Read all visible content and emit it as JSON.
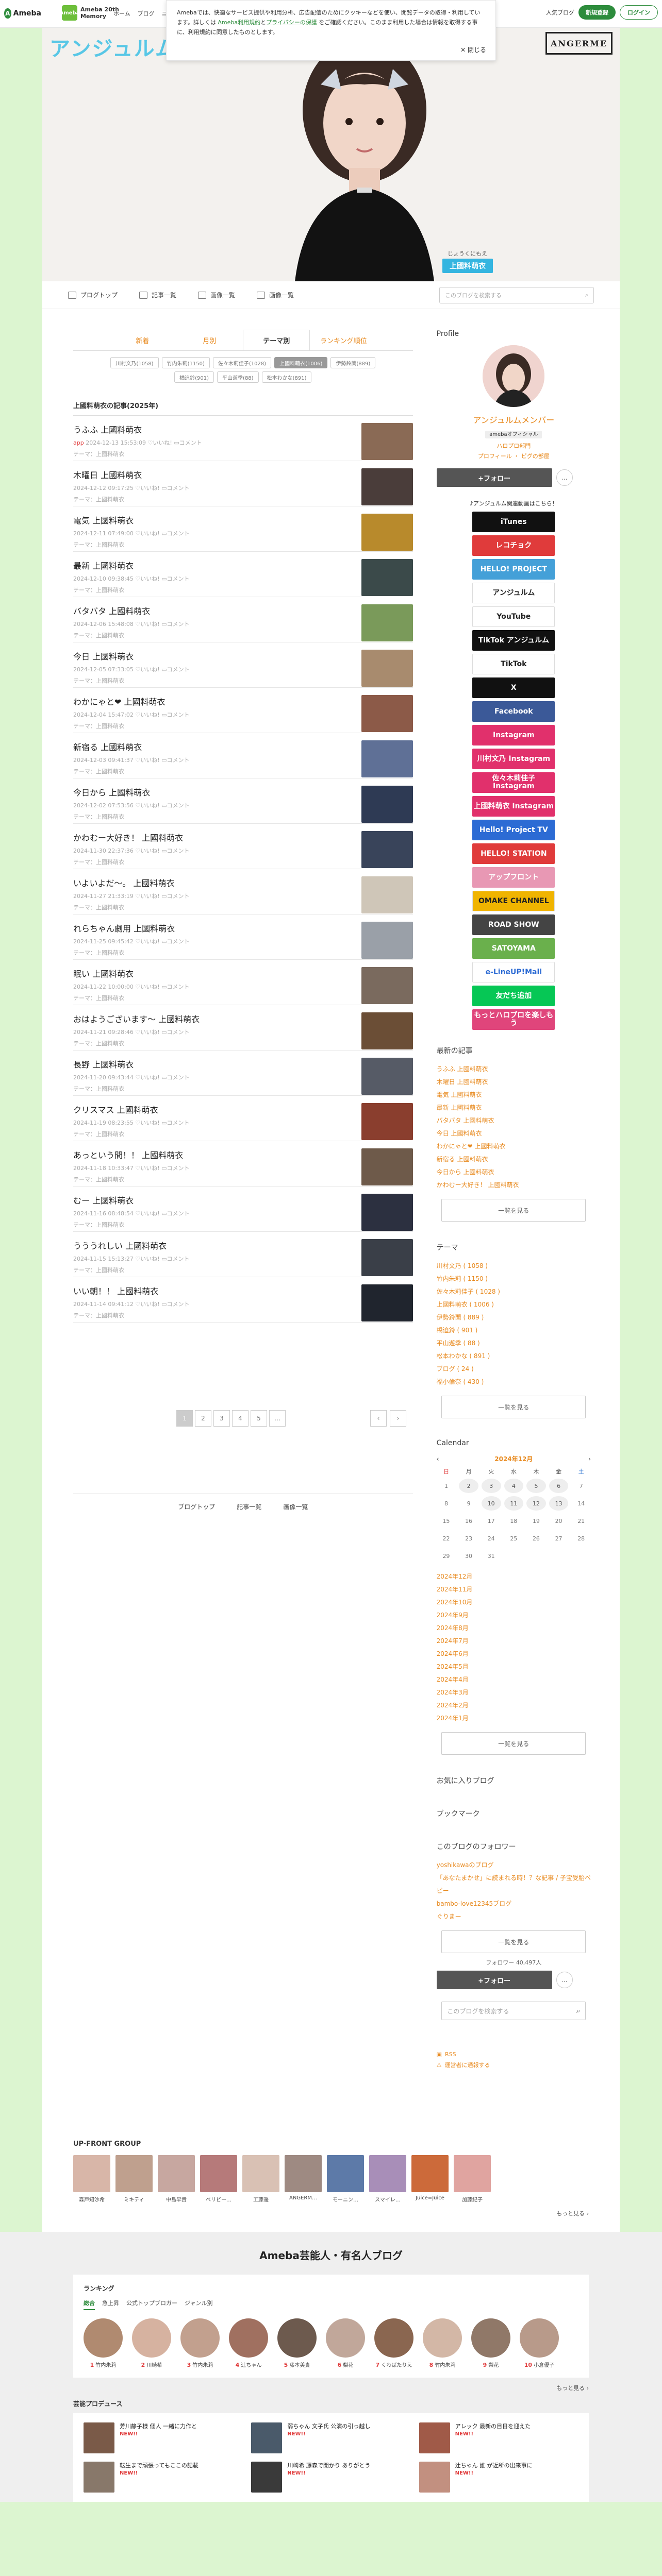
{
  "topbar": {
    "logo_text": "Ameba",
    "blogs_badge": "Ameba",
    "blogs_title": "Ameba 20th Memory",
    "nav": [
      "ホーム",
      "ブログ",
      "ニュース"
    ],
    "small_link": "人気ブログ",
    "register": "新規登録",
    "login": "ログイン"
  },
  "cookie": {
    "text1": "Amebaでは、快適なサービス提供や利用分析、広告配信のためにクッキーなどを使い、閲覧データの取得・利用しています。詳しくは",
    "link1": "Ameba利用規約",
    "and": "と",
    "link2": "プライバシーの保護",
    "text2": "をご確認ください。このまま利用した場合は情報を取得する事に、利用規約に同意したものとします。",
    "close": "閉じる"
  },
  "hero": {
    "title": "アンジュルム",
    "brand": "ANGERME",
    "name_kana": "じょうくにもえ",
    "name_tag": "上國料萌衣"
  },
  "blog_nav": {
    "top": "ブログトップ",
    "entries": "記事一覧",
    "images": "画像一覧",
    "search_placeholder": "このブログを検索する"
  },
  "tabs": {
    "items": [
      "新着",
      "月別",
      "テーマ別",
      "ランキング順位"
    ],
    "active": 2
  },
  "chips": [
    "川村文乃(1058)",
    "竹内朱莉(1150)",
    "佐々木莉佳子(1028)",
    "上國料萌衣(1006)",
    "伊勢鈴蘭(889)",
    "橋迫鈴(901)",
    "平山遊季(88)",
    "松本わかな(891)"
  ],
  "chips_active": 3,
  "section_heading": "上國料萌衣の記事(2025年)",
  "entries": [
    {
      "title": "うふふ 上國料萌衣",
      "date": "2024-12-13 15:53:09",
      "app": "app",
      "likes": "いいね!",
      "comments": "コメント",
      "theme": "テーマ：上國料萌衣",
      "img": "#8a6a55"
    },
    {
      "title": "木曜日 上國料萌衣",
      "date": "2024-12-12 09:17:25",
      "likes": "いいね!",
      "comments": "コメント",
      "theme": "テーマ：上國料萌衣",
      "img": "#4a3d3a"
    },
    {
      "title": "電気 上國料萌衣",
      "date": "2024-12-11 07:49:00",
      "likes": "いいね!",
      "comments": "コメント",
      "theme": "テーマ：上國料萌衣",
      "img": "#b88a2c"
    },
    {
      "title": "最新 上國料萌衣",
      "date": "2024-12-10 09:38:45",
      "likes": "いいね!",
      "comments": "コメント",
      "theme": "テーマ：上國料萌衣",
      "img": "#3b4a4a"
    },
    {
      "title": "バタバタ 上國料萌衣",
      "date": "2024-12-06 15:48:08",
      "likes": "いいね!",
      "comments": "コメント",
      "theme": "テーマ：上國料萌衣",
      "img": "#7a9a5a"
    },
    {
      "title": "今日 上國料萌衣",
      "date": "2024-12-05 07:33:05",
      "likes": "いいね!",
      "comments": "コメント",
      "theme": "テーマ：上國料萌衣",
      "img": "#a88b6e"
    },
    {
      "title": "わかにゃと❤ 上國料萌衣",
      "date": "2024-12-04 15:47:02",
      "likes": "いいね!",
      "comments": "コメント",
      "theme": "テーマ：上國料萌衣",
      "img": "#8c5a48"
    },
    {
      "title": "新宿る 上國料萌衣",
      "date": "2024-12-03 09:41:37",
      "likes": "いいね!",
      "comments": "コメント",
      "theme": "テーマ：上國料萌衣",
      "img": "#5f7096"
    },
    {
      "title": "今日から 上國料萌衣",
      "date": "2024-12-02 07:53:56",
      "likes": "いいね!",
      "comments": "コメント",
      "theme": "テーマ：上國料萌衣",
      "img": "#2e3a54"
    },
    {
      "title": "かわむー大好き！ 上國料萌衣",
      "date": "2024-11-30 22:37:36",
      "likes": "いいね!",
      "comments": "コメント",
      "theme": "テーマ：上國料萌衣",
      "img": "#39445a"
    },
    {
      "title": "いよいよだ〜。 上國料萌衣",
      "date": "2024-11-27 21:33:19",
      "likes": "いいね!",
      "comments": "コメント",
      "theme": "テーマ：上國料萌衣",
      "img": "#cfc6b8"
    },
    {
      "title": "れらちゃん劇用 上國料萌衣",
      "date": "2024-11-25 09:45:42",
      "likes": "いいね!",
      "comments": "コメント",
      "theme": "テーマ：上國料萌衣",
      "img": "#9aa0a8"
    },
    {
      "title": "眠い 上國料萌衣",
      "date": "2024-11-22 10:00:00",
      "likes": "いいね!",
      "comments": "コメント",
      "theme": "テーマ：上國料萌衣",
      "img": "#7a6a5e"
    },
    {
      "title": "おはようございます〜 上國料萌衣",
      "date": "2024-11-21 09:28:46",
      "likes": "いいね!",
      "comments": "コメント",
      "theme": "テーマ：上國料萌衣",
      "img": "#6b4e36"
    },
    {
      "title": "長野 上國料萌衣",
      "date": "2024-11-20 09:43:44",
      "likes": "いいね!",
      "comments": "コメント",
      "theme": "テーマ：上國料萌衣",
      "img": "#565b66"
    },
    {
      "title": "クリスマス 上國料萌衣",
      "date": "2024-11-19 08:23:55",
      "likes": "いいね!",
      "comments": "コメント",
      "theme": "テーマ：上國料萌衣",
      "img": "#8a3e2e"
    },
    {
      "title": "あっという間！！ 上國料萌衣",
      "date": "2024-11-18 10:33:47",
      "likes": "いいね!",
      "comments": "コメント",
      "theme": "テーマ：上國料萌衣",
      "img": "#6e5a4a"
    },
    {
      "title": "むー 上國料萌衣",
      "date": "2024-11-16 08:48:54",
      "likes": "いいね!",
      "comments": "コメント",
      "theme": "テーマ：上國料萌衣",
      "img": "#2c3040"
    },
    {
      "title": "うううれしい 上國料萌衣",
      "date": "2024-11-15 15:13:27",
      "likes": "いいね!",
      "comments": "コメント",
      "theme": "テーマ：上國料萌衣",
      "img": "#3a3f48"
    },
    {
      "title": "いい朝！！ 上國料萌衣",
      "date": "2024-11-14 09:41:12",
      "likes": "いいね!",
      "comments": "コメント",
      "theme": "テーマ：上國料萌衣",
      "img": "#20252e"
    }
  ],
  "pager": {
    "pages": [
      "1",
      "2",
      "3",
      "4",
      "5"
    ],
    "ellipsis": "…",
    "active": 0,
    "prev": "‹",
    "next": "›"
  },
  "bottom_nav": {
    "top": "ブログトップ",
    "entries": "記事一覧",
    "images": "画像一覧"
  },
  "profile": {
    "heading": "Profile",
    "name": "アンジュルムメンバー",
    "badge": "amebaオフィシャル",
    "sub": "ハロプロ部門",
    "links": "プロフィール ・ ピグの部屋",
    "follow": "+フォロー",
    "more": "…"
  },
  "banners_head": "♪アンジュルム関連動画はこちら！",
  "banners": [
    {
      "label": "iTunes",
      "color": "#111111"
    },
    {
      "label": "レコチョク",
      "color": "#e03b3b"
    },
    {
      "label": "HELLO! PROJECT",
      "color": "#44a0d8"
    },
    {
      "label": "アンジュルム",
      "color": "#ffffff",
      "fg": "#222222"
    },
    {
      "label": "YouTube",
      "color": "#ffffff",
      "fg": "#222222"
    },
    {
      "label": "TikTok アンジュルム",
      "color": "#111111"
    },
    {
      "label": "TikTok",
      "color": "#ffffff",
      "fg": "#222222"
    },
    {
      "label": "X",
      "color": "#111111"
    },
    {
      "label": "Facebook",
      "color": "#3b5998"
    },
    {
      "label": "Instagram",
      "color": "#e1306c"
    },
    {
      "label": "川村文乃 Instagram",
      "color": "#e1306c"
    },
    {
      "label": "佐々木莉佳子 Instagram",
      "color": "#e1306c"
    },
    {
      "label": "上國料萌衣 Instagram",
      "color": "#e1306c"
    },
    {
      "label": "Hello! Project TV",
      "color": "#2c6bd4"
    },
    {
      "label": "HELLO! STATION",
      "color": "#e03b3b"
    },
    {
      "label": "アップフロント",
      "color": "#e898b4"
    },
    {
      "label": "OMAKE CHANNEL",
      "color": "#f0b400",
      "fg": "#222222"
    },
    {
      "label": "ROAD SHOW",
      "color": "#444444"
    },
    {
      "label": "SATOYAMA",
      "color": "#6ab04c"
    },
    {
      "label": "e-LineUP!Mall",
      "color": "#ffffff",
      "fg": "#2c6bd4"
    },
    {
      "label": "友だち追加",
      "color": "#06c755"
    },
    {
      "label": "もっとハロプロを楽しもう",
      "color": "#e0457b"
    }
  ],
  "recent": {
    "heading": "最新の記事",
    "items": [
      "うふふ 上國料萌衣",
      "木曜日 上國料萌衣",
      "電気 上國料萌衣",
      "最新 上國料萌衣",
      "バタバタ 上國料萌衣",
      "今日 上國料萌衣",
      "わかにゃと❤ 上國料萌衣",
      "新宿る 上國料萌衣",
      "今日から 上國料萌衣",
      "かわむー大好き！ 上國料萌衣"
    ],
    "more": "一覧を見る"
  },
  "theme": {
    "heading": "テーマ",
    "items": [
      "川村文乃 ( 1058 )",
      "竹内朱莉 ( 1150 )",
      "佐々木莉佳子 ( 1028 )",
      "上國料萌衣 ( 1006 )",
      "伊勢鈴蘭 ( 889 )",
      "橋迫鈴 ( 901 )",
      "平山遊季 ( 88 )",
      "松本わかな ( 891 )",
      "ブログ ( 24 )",
      "福小倫奈 ( 430 )"
    ],
    "more": "一覧を見る"
  },
  "calendar": {
    "heading": "Calendar",
    "month": "2024年12月",
    "prev": "‹",
    "next": "›",
    "days": [
      "日",
      "月",
      "火",
      "水",
      "木",
      "金",
      "土"
    ],
    "dates": [
      "1",
      "2",
      "3",
      "4",
      "5",
      "6",
      "7",
      "8",
      "9",
      "10",
      "11",
      "12",
      "13",
      "14",
      "15",
      "16",
      "17",
      "18",
      "19",
      "20",
      "21",
      "22",
      "23",
      "24",
      "25",
      "26",
      "27",
      "28",
      "29",
      "30",
      "31"
    ],
    "posted": [
      "2",
      "3",
      "4",
      "5",
      "6",
      "10",
      "11",
      "12",
      "13"
    ]
  },
  "archive": {
    "items": [
      "2024年12月",
      "2024年11月",
      "2024年10月",
      "2024年9月",
      "2024年8月",
      "2024年7月",
      "2024年6月",
      "2024年5月",
      "2024年4月",
      "2024年3月",
      "2024年2月",
      "2024年1月"
    ],
    "more": "一覧を見る"
  },
  "fav": {
    "heading": "お気に入りブログ"
  },
  "bookmark": {
    "heading": "ブックマーク"
  },
  "followers": {
    "heading": "このブログのフォロワー",
    "items": [
      "yoshikawaのブログ",
      "「あなたまかせ」に読まれる時！？な記事 / 子宝受胎ベビー",
      "bambo-love12345ブログ",
      "ぐりまー"
    ],
    "more": "一覧を見る",
    "count_label": "フォロワー",
    "count": "40,497人",
    "follow": "+フォロー",
    "more_btn": "…"
  },
  "side_search": {
    "placeholder": "このブログを検索する"
  },
  "footer_links": {
    "rss": "RSS",
    "report": "運営者に通報する"
  },
  "group": {
    "heading": "UP-FRONT GROUP",
    "members": [
      {
        "name": "森戸知沙希",
        "c": "#d8b6a8"
      },
      {
        "name": "ミキティ",
        "c": "#bfa08e"
      },
      {
        "name": "中島早貴",
        "c": "#c7a7a0"
      },
      {
        "name": "ベリビー…",
        "c": "#b67a7a"
      },
      {
        "name": "工藤遥",
        "c": "#d9c1b4"
      },
      {
        "name": "ANGERM…",
        "c": "#9e8a82"
      },
      {
        "name": "モーニン…",
        "c": "#5d7aa8"
      },
      {
        "name": "スマイレ…",
        "c": "#a88eb8"
      },
      {
        "name": "Juice=Juice",
        "c": "#cc6a3a"
      },
      {
        "name": "加藤紀子",
        "c": "#e0a4a0"
      }
    ],
    "more": "もっと見る ›"
  },
  "famous": {
    "title": "Ameba芸能人・有名人ブログ",
    "ranking": "ランキング",
    "tabs": [
      "総合",
      "急上昇",
      "公式トップブロガー",
      "ジャンル別"
    ],
    "people": [
      {
        "name": "竹内朱莉",
        "n": "1",
        "c": "#b08a70"
      },
      {
        "name": "川崎希",
        "n": "2",
        "c": "#d6b2a0"
      },
      {
        "name": "竹内朱莉",
        "n": "3",
        "c": "#c2a08e"
      },
      {
        "name": "辻ちゃん",
        "n": "4",
        "c": "#a07060"
      },
      {
        "name": "藤本美貴",
        "n": "5",
        "c": "#6d5a4e"
      },
      {
        "name": "梨花",
        "n": "6",
        "c": "#c1a79a"
      },
      {
        "name": "くわばたりえ",
        "n": "7",
        "c": "#8a6650"
      },
      {
        "name": "竹内朱莉",
        "n": "8",
        "c": "#d3b7a6"
      },
      {
        "name": "梨花",
        "n": "9",
        "c": "#907868"
      },
      {
        "name": "小倉優子",
        "n": "10",
        "c": "#b89a8a"
      }
    ],
    "more": "もっと見る ›",
    "producer_heading": "芸能プロデュース",
    "producers": [
      {
        "t": "芳川静子様 個人 一緒に力作と",
        "c": "#7a5a48",
        "new": "NEW!!"
      },
      {
        "t": "弱ちゃん 文子氏 公演の引っ越し",
        "c": "#4a5a6a",
        "new": "NEW!!"
      },
      {
        "t": "アレック 最新の目日を迎えた",
        "c": "#a05a48",
        "new": "NEW!!"
      },
      {
        "t": "転生まで頑張ってもここの記載",
        "c": "#88786a",
        "new": "NEW!!"
      },
      {
        "t": "川崎希 藤森で聞かり ありがとう",
        "c": "#3a3a3a",
        "new": "NEW!!"
      },
      {
        "t": "辻ちゃん 誰 が近所の出来事に",
        "c": "#c29080",
        "new": "NEW!!"
      }
    ]
  }
}
